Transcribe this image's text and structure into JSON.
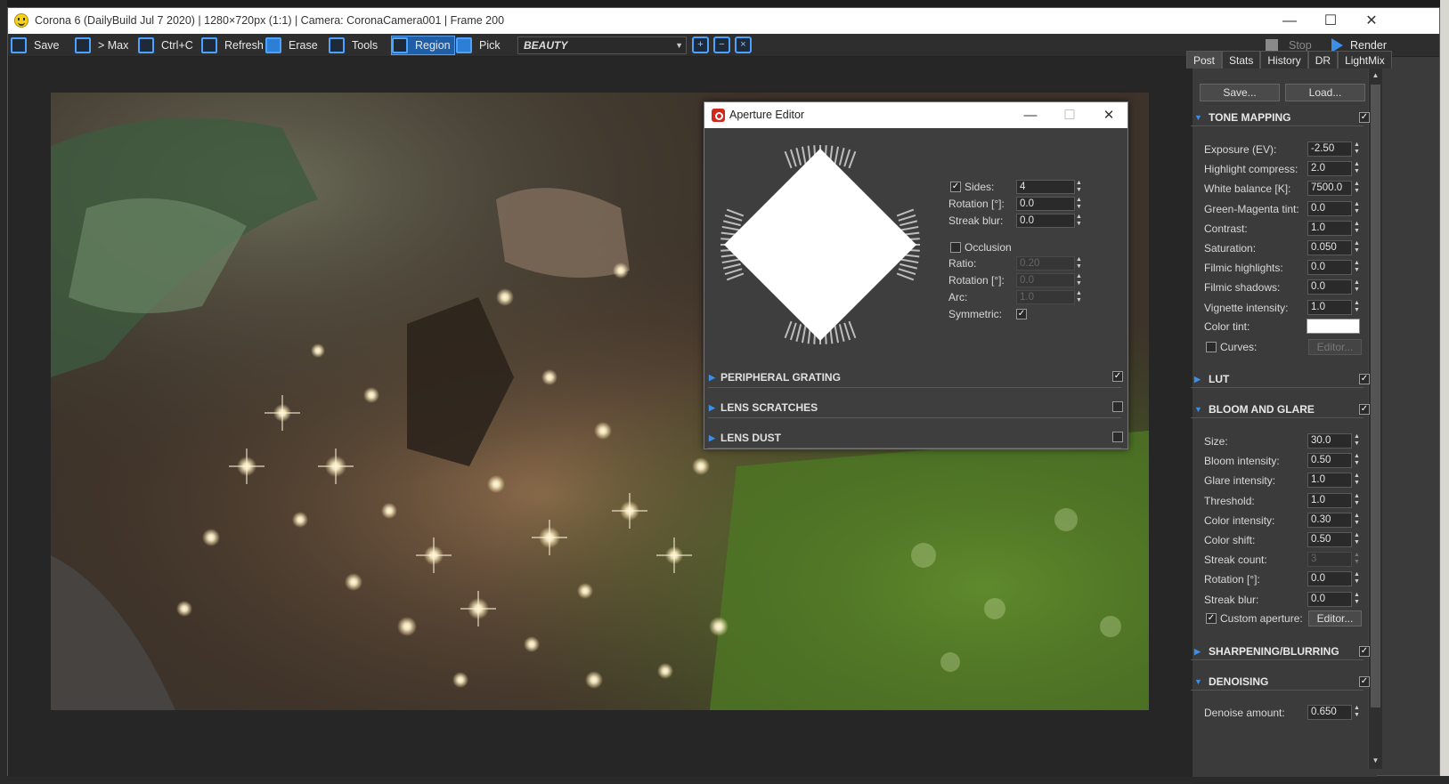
{
  "window": {
    "title": "Corona 6 (DailyBuild Jul  7 2020) | 1280×720px (1:1) | Camera: CoronaCamera001 | Frame 200",
    "controls": {
      "minimize": "—",
      "maximize": "☐",
      "close": "✕"
    }
  },
  "toolbar": {
    "save": "Save",
    "to_max": "> Max",
    "copy": "Ctrl+C",
    "refresh": "Refresh",
    "erase": "Erase",
    "tools": "Tools",
    "region": "Region",
    "pick": "Pick",
    "pass": "BEAUTY",
    "stop": "Stop",
    "render": "Render"
  },
  "panel": {
    "tabs": [
      "Post",
      "Stats",
      "History",
      "DR",
      "LightMix"
    ],
    "save_btn": "Save...",
    "load_btn": "Load...",
    "tone_mapping": {
      "title": "TONE MAPPING",
      "enabled": true,
      "rows": [
        {
          "label": "Exposure (EV):",
          "value": "-2.50"
        },
        {
          "label": "Highlight compress:",
          "value": "2.0"
        },
        {
          "label": "White balance [K]:",
          "value": "7500.0"
        },
        {
          "label": "Green-Magenta tint:",
          "value": "0.0"
        },
        {
          "label": "Contrast:",
          "value": "1.0"
        },
        {
          "label": "Saturation:",
          "value": "0.050"
        },
        {
          "label": "Filmic highlights:",
          "value": "0.0"
        },
        {
          "label": "Filmic shadows:",
          "value": "0.0"
        },
        {
          "label": "Vignette intensity:",
          "value": "1.0"
        }
      ],
      "color_tint_label": "Color tint:",
      "color_tint": "#ffffff",
      "curves_label": "Curves:",
      "curves_editor": "Editor..."
    },
    "lut": {
      "title": "LUT",
      "enabled": true
    },
    "bloom_glare": {
      "title": "BLOOM AND GLARE",
      "enabled": true,
      "rows": [
        {
          "label": "Size:",
          "value": "30.0",
          "disabled": false
        },
        {
          "label": "Bloom intensity:",
          "value": "0.50",
          "disabled": false
        },
        {
          "label": "Glare intensity:",
          "value": "1.0",
          "disabled": false
        },
        {
          "label": "Threshold:",
          "value": "1.0",
          "disabled": false
        },
        {
          "label": "Color intensity:",
          "value": "0.30",
          "disabled": false
        },
        {
          "label": "Color shift:",
          "value": "0.50",
          "disabled": false
        },
        {
          "label": "Streak count:",
          "value": "3",
          "disabled": true
        },
        {
          "label": "Rotation [°]:",
          "value": "0.0",
          "disabled": false
        },
        {
          "label": "Streak blur:",
          "value": "0.0",
          "disabled": false
        }
      ],
      "custom_aperture_label": "Custom aperture:",
      "custom_aperture_checked": true,
      "editor_btn": "Editor..."
    },
    "sharpening": {
      "title": "SHARPENING/BLURRING",
      "enabled": true
    },
    "denoising": {
      "title": "DENOISING",
      "enabled": true,
      "amount_label": "Denoise amount:",
      "amount": "0.650"
    }
  },
  "aperture": {
    "title": "Aperture Editor",
    "sides_label": "Sides:",
    "sides": "4",
    "sides_checked": true,
    "rotation_label": "Rotation [°]:",
    "rotation": "0.0",
    "streak_blur_label": "Streak blur:",
    "streak_blur": "0.0",
    "occlusion_label": "Occlusion",
    "occlusion_checked": false,
    "ratio_label": "Ratio:",
    "ratio": "0.20",
    "occ_rotation_label": "Rotation [°]:",
    "occ_rotation": "0.0",
    "arc_label": "Arc:",
    "arc": "1.0",
    "symmetric_label": "Symmetric:",
    "symmetric_checked": true,
    "sections": [
      {
        "title": "PERIPHERAL GRATING",
        "checked": true
      },
      {
        "title": "LENS SCRATCHES",
        "checked": false
      },
      {
        "title": "LENS DUST",
        "checked": false
      }
    ]
  },
  "colors": {
    "accent": "#3b8fe8",
    "panel": "#3b3b3b",
    "viewport": "#262626"
  }
}
